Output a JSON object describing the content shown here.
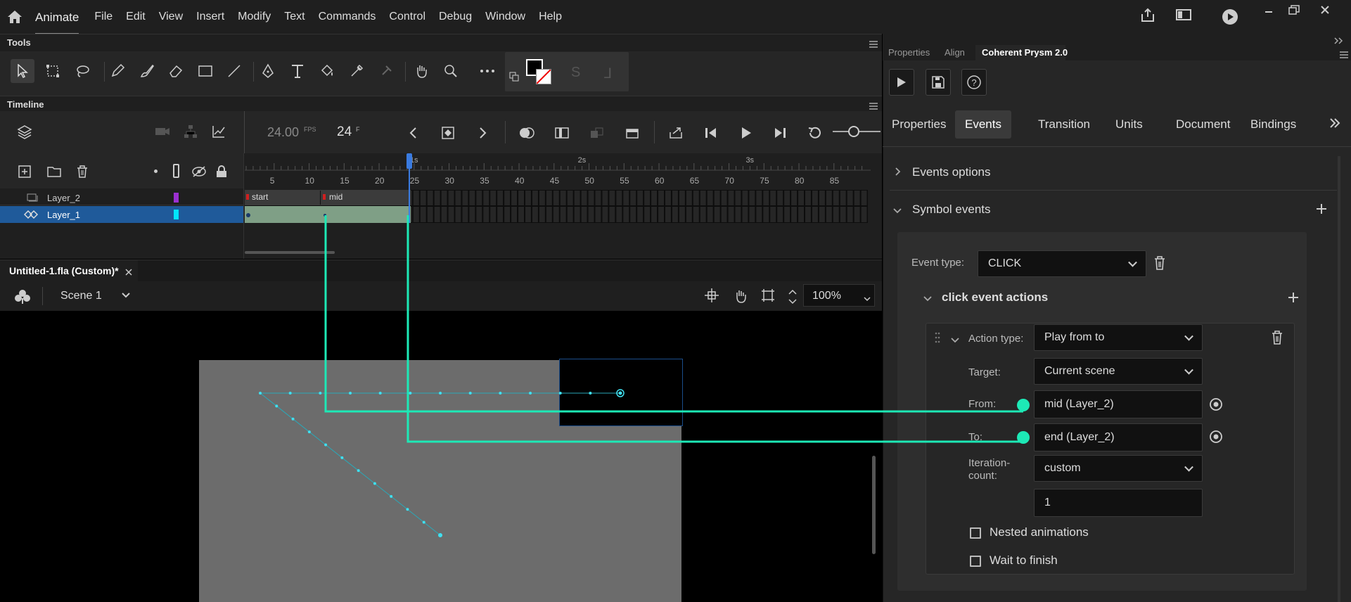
{
  "app": {
    "name": "Animate"
  },
  "menu": [
    "File",
    "Edit",
    "View",
    "Insert",
    "Modify",
    "Text",
    "Commands",
    "Control",
    "Debug",
    "Window",
    "Help"
  ],
  "tools_panel": {
    "title": "Tools"
  },
  "timeline": {
    "title": "Timeline",
    "fps": "24.00",
    "fps_unit": "FPS",
    "frame": "24",
    "frame_unit": "F",
    "ruler_numbers": [
      "5",
      "10",
      "15",
      "20",
      "25",
      "30",
      "35",
      "40",
      "45",
      "50",
      "55",
      "60",
      "65",
      "70",
      "75",
      "80",
      "85"
    ],
    "seconds": [
      "1s",
      "2s",
      "3s"
    ],
    "layers": [
      {
        "name": "Layer_2",
        "color": "#9b30d0",
        "selected": false
      },
      {
        "name": "Layer_1",
        "color": "#00e5ff",
        "selected": true
      }
    ],
    "frame_labels": [
      "start",
      "mid"
    ]
  },
  "document": {
    "tab": "Untitled-1.fla (Custom)*",
    "scene": "Scene 1",
    "zoom": "100%"
  },
  "right_panel": {
    "tabs": [
      "Properties",
      "Align",
      "Coherent Prysm 2.0"
    ],
    "active_tab": "Coherent Prysm 2.0",
    "subtabs": [
      "Properties",
      "Events",
      "Transition",
      "Units",
      "Document",
      "Bindings"
    ],
    "active_subtab": "Events",
    "events_options": "Events options",
    "symbol_events": "Symbol events",
    "event_type_label": "Event type:",
    "event_type_value": "CLICK",
    "actions_title": "click event actions",
    "action_type_label": "Action type:",
    "action_type_value": "Play from to",
    "target_label": "Target:",
    "target_value": "Current scene",
    "from_label": "From:",
    "from_value": "mid (Layer_2)",
    "to_label": "To:",
    "to_value": "end (Layer_2)",
    "iteration_label_1": "Iteration-",
    "iteration_label_2": "count:",
    "iteration_value": "custom",
    "iteration_count": "1",
    "nested_label": "Nested animations",
    "wait_label": "Wait to finish"
  },
  "colors": {
    "accent": "#1de9b6",
    "selected_layer": "#1f5a9a",
    "playhead": "#3a7be0"
  }
}
